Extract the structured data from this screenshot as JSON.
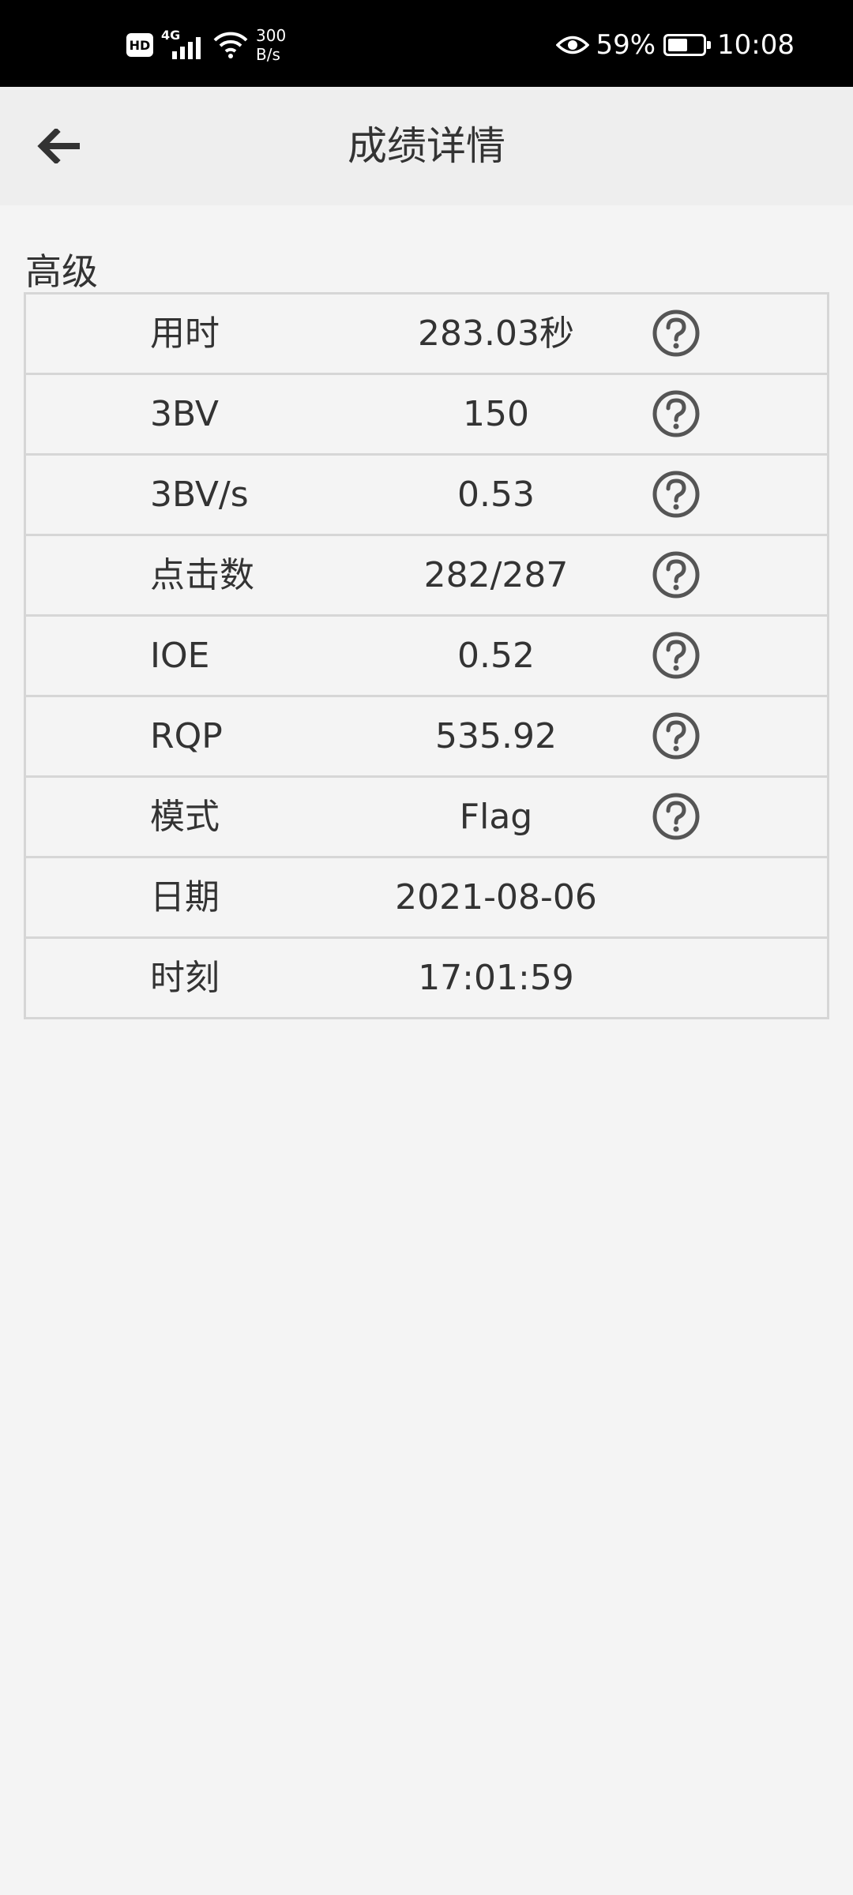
{
  "status_bar": {
    "hd": "HD",
    "network": "4G",
    "speed_value": "300",
    "speed_unit": "B/s",
    "battery": "59%",
    "time": "10:08"
  },
  "header": {
    "title": "成绩详情"
  },
  "section": {
    "title": "高级"
  },
  "rows": [
    {
      "label": "用时",
      "value": "283.03秒",
      "has_help": true
    },
    {
      "label": "3BV",
      "value": "150",
      "has_help": true
    },
    {
      "label": "3BV/s",
      "value": "0.53",
      "has_help": true
    },
    {
      "label": "点击数",
      "value": "282/287",
      "has_help": true
    },
    {
      "label": "IOE",
      "value": "0.52",
      "has_help": true
    },
    {
      "label": "RQP",
      "value": "535.92",
      "has_help": true
    },
    {
      "label": "模式",
      "value": "Flag",
      "has_help": true
    },
    {
      "label": "日期",
      "value": "2021-08-06",
      "has_help": false
    },
    {
      "label": "时刻",
      "value": "17:01:59",
      "has_help": false
    }
  ],
  "icons": {
    "back": "arrow-left-icon",
    "help": "question-circle-icon"
  },
  "colors": {
    "status_bar_bg": "#000000",
    "app_bar_bg": "#eeeeee",
    "page_bg": "#f4f4f4",
    "border": "#d6d6d6",
    "text": "#333333",
    "icon": "#555555"
  }
}
